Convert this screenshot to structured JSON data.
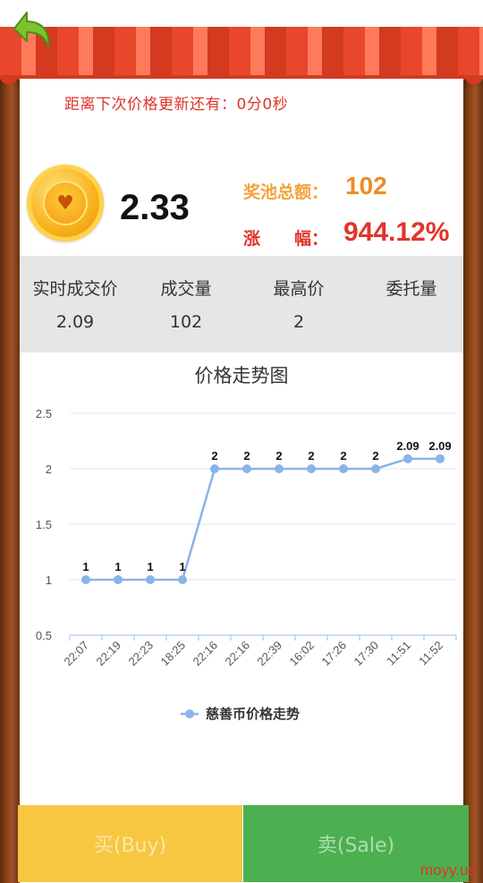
{
  "countdown": {
    "text": "距离下次价格更新还有：0分0秒"
  },
  "coin": {
    "price": "2.33"
  },
  "pool": {
    "label": "奖池总额：",
    "value": "102"
  },
  "change": {
    "label": "涨　　幅：",
    "value": "944.12%"
  },
  "stats": [
    {
      "label": "实时成交价",
      "value": "2.09"
    },
    {
      "label": "成交量",
      "value": "102"
    },
    {
      "label": "最高价",
      "value": "2"
    },
    {
      "label": "委托量",
      "value": ""
    }
  ],
  "buttons": {
    "buy": "买(Buy)",
    "sale": "卖(Sale)"
  },
  "watermark": "moyy.us",
  "colors": {
    "accent_red": "#e0342a",
    "orange": "#f08b24",
    "line": "#8ab4e8",
    "buy": "#f7c742",
    "sale": "#4caf50"
  },
  "chart_data": {
    "type": "line",
    "title": "价格走势图",
    "categories": [
      "22:07",
      "22:19",
      "22:23",
      "18:25",
      "22:16",
      "22:16",
      "22:39",
      "16:02",
      "17:26",
      "17:30",
      "11:51",
      "11:52"
    ],
    "series": [
      {
        "name": "慈善币价格走势",
        "values": [
          1,
          1,
          1,
          1,
          2,
          2,
          2,
          2,
          2,
          2,
          2.09,
          2.09
        ]
      }
    ],
    "data_labels": [
      "1",
      "1",
      "1",
      "1",
      "2",
      "2",
      "2",
      "2",
      "2",
      "2",
      "2.09",
      "2.09"
    ],
    "y_ticks": [
      "0.5",
      "1",
      "1.5",
      "2",
      "2.5"
    ],
    "ylim": [
      0.5,
      2.5
    ],
    "grid": true,
    "legend": "bottom"
  }
}
